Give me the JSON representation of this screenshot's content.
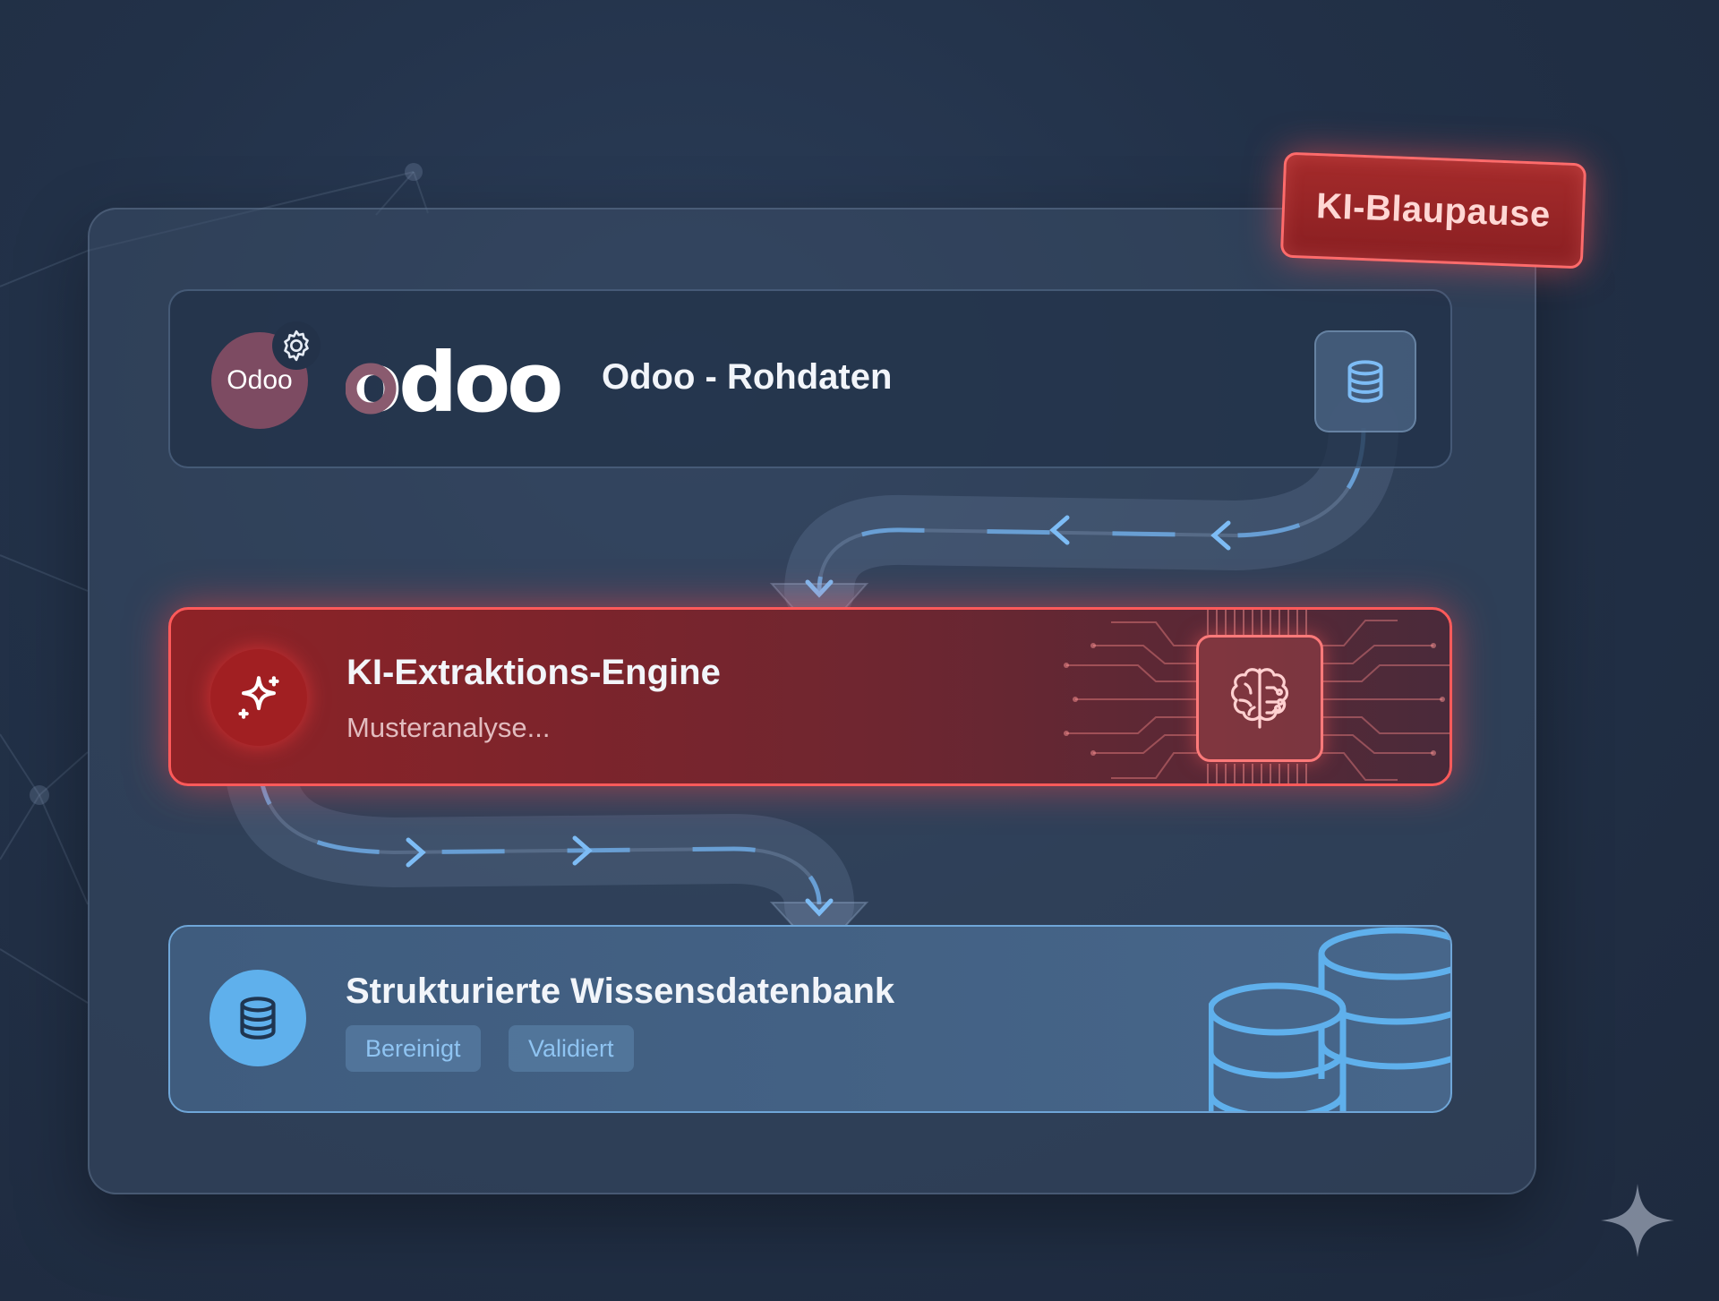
{
  "badge": {
    "label": "KI-Blaupause"
  },
  "source": {
    "avatar_text": "Odoo",
    "logo_text": "odoo",
    "title": "Odoo - Rohdaten"
  },
  "engine": {
    "title": "KI-Extraktions-Engine",
    "subtitle": "Musteranalyse..."
  },
  "knowledge_base": {
    "title": "Strukturierte Wissensdatenbank",
    "tags": [
      "Bereinigt",
      "Validiert"
    ]
  },
  "icons": {
    "source_avatar": "odoo-avatar",
    "source_settings": "gear-icon",
    "source_db": "database-icon",
    "engine_icon": "sparkle-icon",
    "engine_chip": "brain-chip-icon",
    "kb_icon": "database-icon",
    "kb_art": "database-stack-icon",
    "corner_mark": "sparkle-icon"
  },
  "colors": {
    "accent_red": "#ff5a5a",
    "accent_blue": "#5fb0ec",
    "odoo_purple": "#7d4b62"
  }
}
